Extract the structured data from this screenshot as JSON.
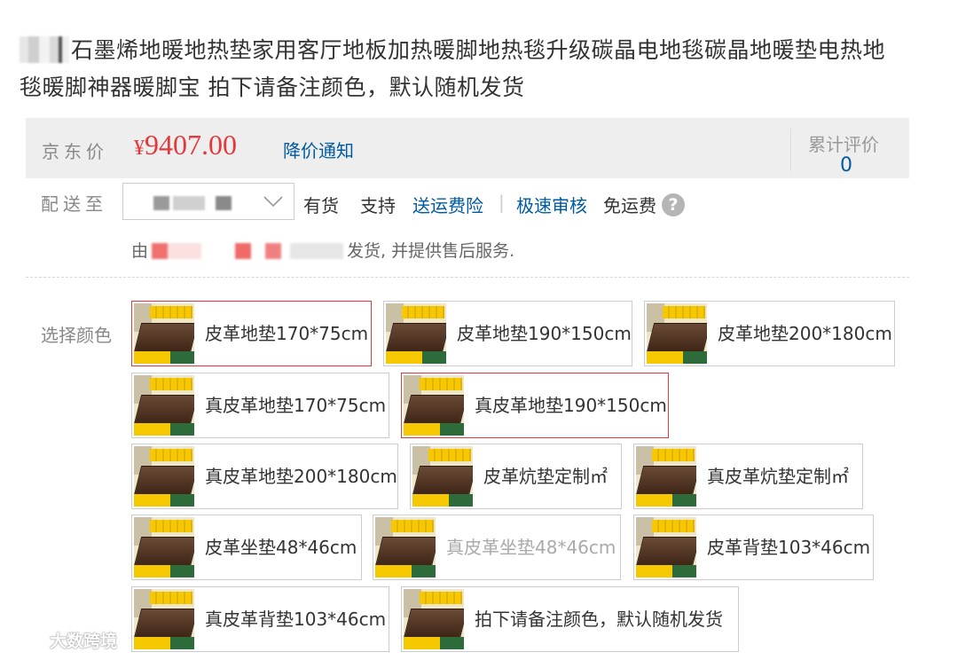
{
  "product": {
    "title": "石墨烯地暖地热垫家用客厅地板加热暖脚地热毯升级碳晶电地毯碳晶地暖垫电热地毯暖脚神器暖脚宝 拍下请备注颜色，默认随机发货"
  },
  "price": {
    "label": "京东价",
    "currency": "¥",
    "value": "9407.00",
    "notify_link": "降价通知",
    "rating_label": "累计评价",
    "rating_count": "0"
  },
  "shipping": {
    "label": "配送至",
    "in_stock": "有货",
    "support": "支持",
    "insurance_link": "送运费险",
    "separator": "|",
    "fast_review_link": "极速审核",
    "free_shipping": "免运费",
    "help_glyph": "?",
    "by_prefix": "由",
    "by_suffix": "发货, 并提供售后服务."
  },
  "colors": {
    "label": "选择颜色",
    "options": [
      {
        "label": "皮革地垫170*75cm",
        "selected": true
      },
      {
        "label": "皮革地垫190*150cm"
      },
      {
        "label": "皮革地垫200*180cm"
      },
      {
        "label": "真皮革地垫170*75cm"
      },
      {
        "label": "真皮革地垫190*150cm",
        "selected": true
      },
      {
        "label": "真皮革地垫200*180cm"
      },
      {
        "label": "皮革炕垫定制㎡"
      },
      {
        "label": "真皮革炕垫定制㎡"
      },
      {
        "label": "皮革坐垫48*46cm"
      },
      {
        "label": "真皮革坐垫48*46cm",
        "disabled": true
      },
      {
        "label": "皮革背垫103*46cm"
      },
      {
        "label": "真皮革背垫103*46cm"
      },
      {
        "label": "拍下请备注颜色，默认随机发货"
      }
    ]
  },
  "watermark": "大数跨境",
  "theme": {
    "price_red": "#e4393c",
    "link_blue": "#005aa0",
    "bar_gray": "#eeeeee"
  }
}
